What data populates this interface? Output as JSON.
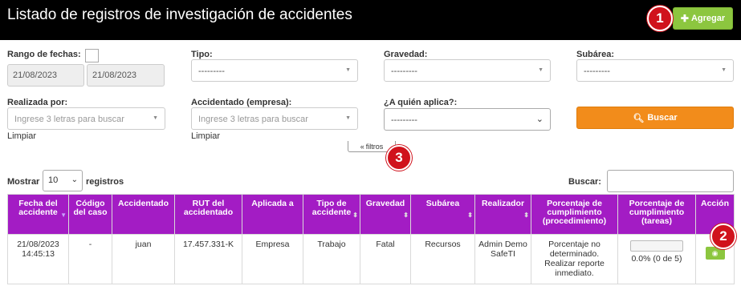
{
  "header": {
    "title": "Listado de registros de investigación de accidentes",
    "add_button": "Agregar"
  },
  "badges": [
    "1",
    "2",
    "3"
  ],
  "filters": {
    "date_range_label": "Rango de fechas:",
    "date_from": "21/08/2023",
    "date_to": "21/08/2023",
    "tipo_label": "Tipo:",
    "tipo_value": "---------",
    "gravedad_label": "Gravedad:",
    "gravedad_value": "---------",
    "subarea_label": "Subárea:",
    "subarea_value": "---------",
    "realizada_label": "Realizada por:",
    "realizada_placeholder": "Ingrese 3 letras para buscar",
    "accidentado_label": "Accidentado (empresa):",
    "accidentado_placeholder": "Ingrese 3 letras para buscar",
    "aplica_label": "¿A quién aplica?:",
    "aplica_value": "---------",
    "limpiar_1": "Limpiar",
    "limpiar_2": "Limpiar",
    "search_button": "Buscar",
    "toggle_label": "filtros"
  },
  "table_controls": {
    "show_label": "Mostrar",
    "page_length": "10",
    "records_label": "registros",
    "search_label": "Buscar:"
  },
  "table": {
    "headers": [
      "Fecha del accidente",
      "Código del caso",
      "Accidentado",
      "RUT del accidentado",
      "Aplicada a",
      "Tipo de accidente",
      "Gravedad",
      "Subárea",
      "Realizador",
      "Porcentaje de cumplimiento (procedimiento)",
      "Porcentaje de cumplimiento (tareas)",
      "Acción"
    ],
    "rows": [
      {
        "fecha": "21/08/2023 14:45:13",
        "codigo": "-",
        "accidentado": "juan",
        "rut": "17.457.331-K",
        "aplicada": "Empresa",
        "tipo": "Trabajo",
        "gravedad": "Fatal",
        "subarea": "Recursos",
        "realizador": "Admin Demo SafeTI",
        "procedimiento": "Porcentaje no determinado. Realizar reporte inmediato.",
        "tareas": "0.0% (0 de 5)",
        "tareas_fraction": 0.0
      }
    ]
  },
  "colors": {
    "header_bg": "#000000",
    "table_header": "#a31cc4",
    "add_button": "#8cc63f",
    "search_button": "#f28c1b",
    "badge": "#d0121c"
  }
}
